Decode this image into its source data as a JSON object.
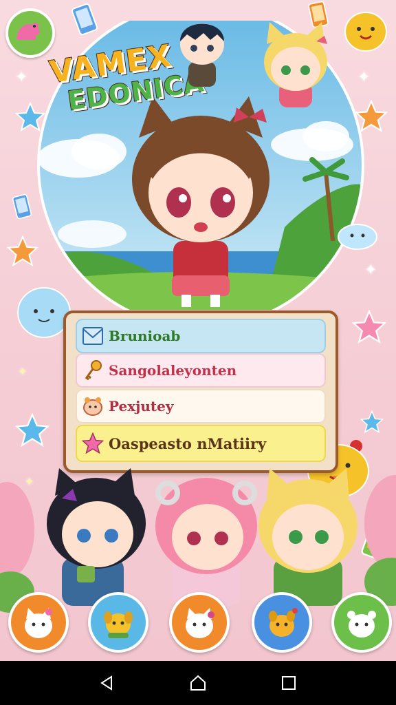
{
  "game": {
    "logo_line1": "VAMEX",
    "logo_line2": "EDONICA"
  },
  "menu": {
    "items": [
      {
        "label": "Brunioab",
        "icon": "mail-icon"
      },
      {
        "label": "Sangolaleyonten",
        "icon": "key-icon"
      },
      {
        "label": "Pexjutey",
        "icon": "pet-icon"
      },
      {
        "label": "Oaspeasto nMatiiry",
        "icon": "star-icon"
      }
    ]
  },
  "bottom_buttons": [
    {
      "name": "pet-button-cat",
      "color": "#f08a2a"
    },
    {
      "name": "pet-button-dog",
      "color": "#5ab8e6"
    },
    {
      "name": "pet-button-kitten",
      "color": "#f08a2a"
    },
    {
      "name": "pet-button-puppy",
      "color": "#4a90e0"
    },
    {
      "name": "pet-button-bear",
      "color": "#6cc04a"
    }
  ],
  "colors": {
    "background": "#f6d2d8",
    "panel_border": "#9a5a2c",
    "accent_green": "#7bc24a"
  },
  "system_nav": [
    "back-icon",
    "home-icon",
    "recents-icon"
  ]
}
